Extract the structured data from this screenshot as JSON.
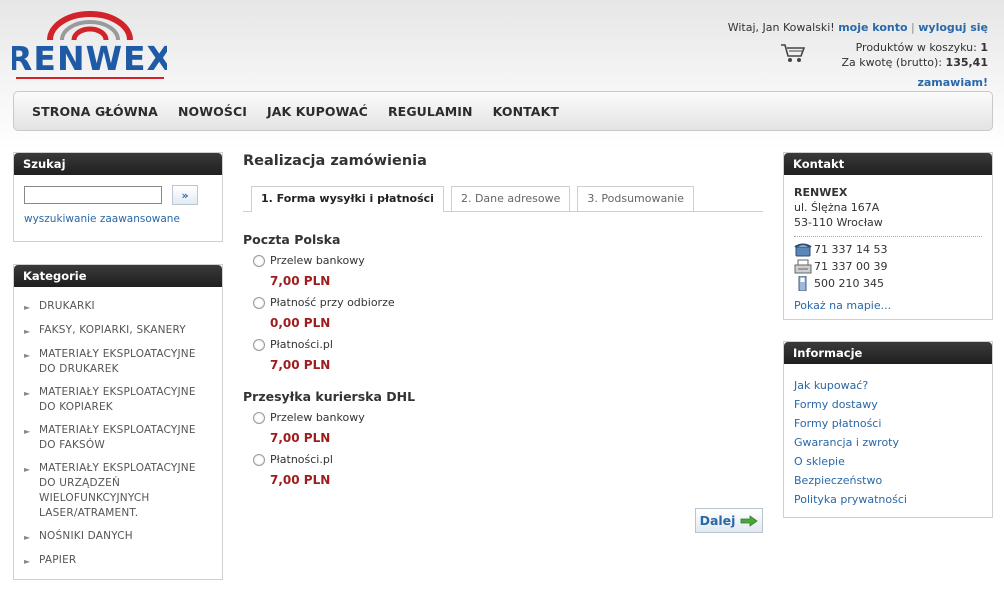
{
  "header": {
    "logo_text": "RENWEX",
    "greeting": "Witaj, Jan Kowalski!",
    "my_account": "moje konto",
    "separator": "|",
    "logout": "wyloguj się",
    "cart": {
      "items_label": "Produktów w koszyku:",
      "items_count": "1",
      "total_label": "Za kwotę (brutto):",
      "total_value": "135,41"
    },
    "order_link": "zamawiam!"
  },
  "nav": {
    "items": [
      "STRONA GŁÓWNA",
      "NOWOŚCI",
      "JAK KUPOWAĆ",
      "REGULAMIN",
      "KONTAKT"
    ]
  },
  "search": {
    "title": "Szukaj",
    "input_value": "",
    "button": "»",
    "advanced": "wyszukiwanie zaawansowane"
  },
  "categories": {
    "title": "Kategorie",
    "items": [
      "DRUKARKI",
      "FAKSY, KOPIARKI, SKANERY",
      "MATERIAŁY EKSPLOATACYJNE DO DRUKAREK",
      "MATERIAŁY EKSPLOATACYJNE DO KOPIAREK",
      "MATERIAŁY EKSPLOATACYJNE DO FAKSÓW",
      "MATERIAŁY EKSPLOATACYJNE DO URZĄDZEŃ WIELOFUNKCYJNYCH LASER/ATRAMENT.",
      "NOŚNIKI DANYCH",
      "PAPIER"
    ]
  },
  "main": {
    "title": "Realizacja zamówienia",
    "tabs": [
      "1. Forma wysyłki i płatności",
      "2. Dane adresowe",
      "3. Podsumowanie"
    ],
    "active_tab": 0,
    "groups": [
      {
        "name": "Poczta Polska",
        "options": [
          {
            "label": "Przelew bankowy",
            "price": "7,00 PLN"
          },
          {
            "label": "Płatność przy odbiorze",
            "price": "0,00 PLN"
          },
          {
            "label": "Płatności.pl",
            "price": "7,00 PLN"
          }
        ]
      },
      {
        "name": "Przesyłka kurierska DHL",
        "options": [
          {
            "label": "Przelew bankowy",
            "price": "7,00 PLN"
          },
          {
            "label": "Płatności.pl",
            "price": "7,00 PLN"
          }
        ]
      }
    ],
    "next_button": "Dalej"
  },
  "contact": {
    "title": "Kontakt",
    "company": "RENWEX",
    "street": "ul. Ślężna 167A",
    "city": "53-110 Wrocław",
    "phone": "71 337 14 53",
    "fax": "71 337 00 39",
    "mobile": "500 210 345",
    "map_link": "Pokaż na mapie..."
  },
  "info": {
    "title": "Informacje",
    "items": [
      "Jak kupować?",
      "Formy dostawy",
      "Formy płatności",
      "Gwarancja i zwroty",
      "O sklepie",
      "Bezpieczeństwo",
      "Polityka prywatności"
    ]
  },
  "colors": {
    "link": "#2a68a8",
    "price": "#a11c1c",
    "logo_blue": "#1f5aa6",
    "logo_red": "#d2232a"
  }
}
